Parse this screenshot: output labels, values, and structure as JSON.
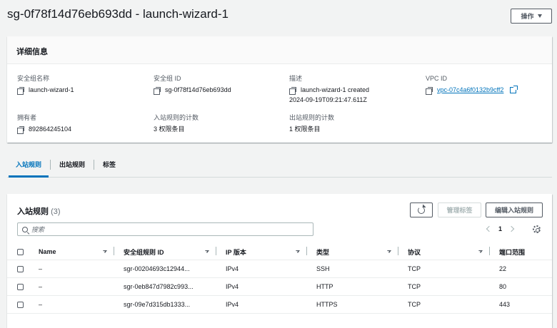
{
  "header": {
    "title": "sg-0f78f14d76eb693dd - launch-wizard-1",
    "actions_label": "操作"
  },
  "details": {
    "heading": "详细信息",
    "fields": [
      {
        "label": "安全组名称",
        "value": "launch-wizard-1"
      },
      {
        "label": "安全组 ID",
        "value": "sg-0f78f14d76eb693dd"
      },
      {
        "label": "描述",
        "value": "launch-wizard-1 created",
        "value2": "2024-09-19T09:21:47.611Z"
      },
      {
        "label": "VPC ID",
        "value": "vpc-07c4a6f0132b9cff2"
      },
      {
        "label": "拥有者",
        "value": "892864245104"
      },
      {
        "label": "入站规则的计数",
        "value": "3 权限条目"
      },
      {
        "label": "出站规则的计数",
        "value": "1 权限条目"
      }
    ]
  },
  "tabs": [
    {
      "label": "入站规则",
      "active": true
    },
    {
      "label": "出站规则",
      "active": false
    },
    {
      "label": "标签",
      "active": false
    }
  ],
  "rules": {
    "title": "入站规则",
    "count": "(3)",
    "manage_tags_label": "管理标签",
    "edit_label": "编辑入站规则",
    "search_placeholder": "搜索",
    "page": "1",
    "columns": [
      "Name",
      "安全组规则 ID",
      "IP 版本",
      "类型",
      "协议",
      "端口范围"
    ],
    "rows": [
      {
        "name": "–",
        "rule_id": "sgr-00204693c12944...",
        "ip_version": "IPv4",
        "type": "SSH",
        "protocol": "TCP",
        "port": "22"
      },
      {
        "name": "–",
        "rule_id": "sgr-0eb847d7982c993...",
        "ip_version": "IPv4",
        "type": "HTTP",
        "protocol": "TCP",
        "port": "80"
      },
      {
        "name": "–",
        "rule_id": "sgr-09e7d315db1333...",
        "ip_version": "IPv4",
        "type": "HTTPS",
        "protocol": "TCP",
        "port": "443"
      }
    ]
  },
  "icons": {
    "copy": "copy-icon",
    "external": "external-link-icon",
    "refresh": "refresh-icon",
    "search": "search-icon",
    "settings": "gear-icon"
  },
  "colors": {
    "accent": "#0073bb",
    "background": "#f2f3f3",
    "border": "#545b64"
  }
}
